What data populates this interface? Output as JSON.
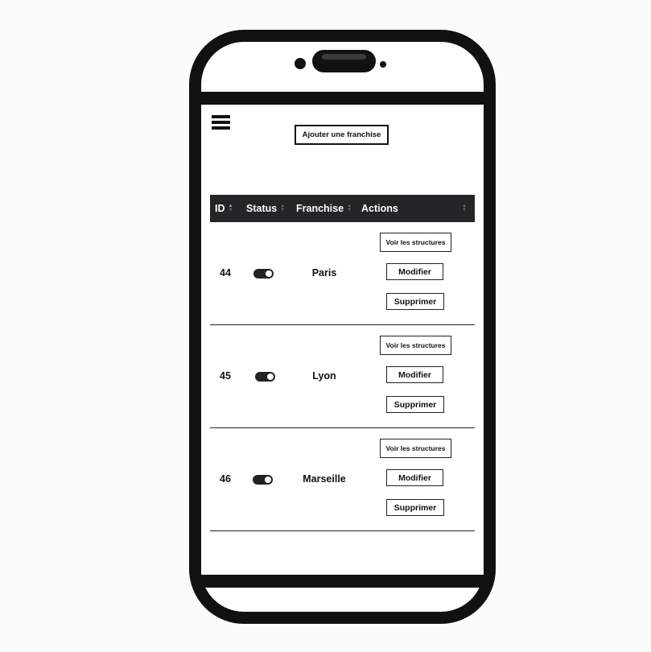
{
  "toolbar": {
    "add_label": "Ajouter une franchise"
  },
  "table": {
    "headers": [
      "ID",
      "Status",
      "Franchise",
      "Actions"
    ],
    "rows": [
      {
        "id": "44",
        "status": "active",
        "franchise": "Paris"
      },
      {
        "id": "45",
        "status": "active",
        "franchise": "Lyon"
      },
      {
        "id": "46",
        "status": "active",
        "franchise": "Marseille"
      }
    ],
    "actions": {
      "view_label": "Voir les structures",
      "edit_label": "Modifier",
      "delete_label": "Supprimer"
    }
  },
  "icons": {
    "menu": "hamburger-menu-icon",
    "sort": "sort-arrows-icon",
    "toggle": "toggle-switch-icon"
  },
  "colors": {
    "header_bg": "#242527",
    "frame": "#111111"
  }
}
